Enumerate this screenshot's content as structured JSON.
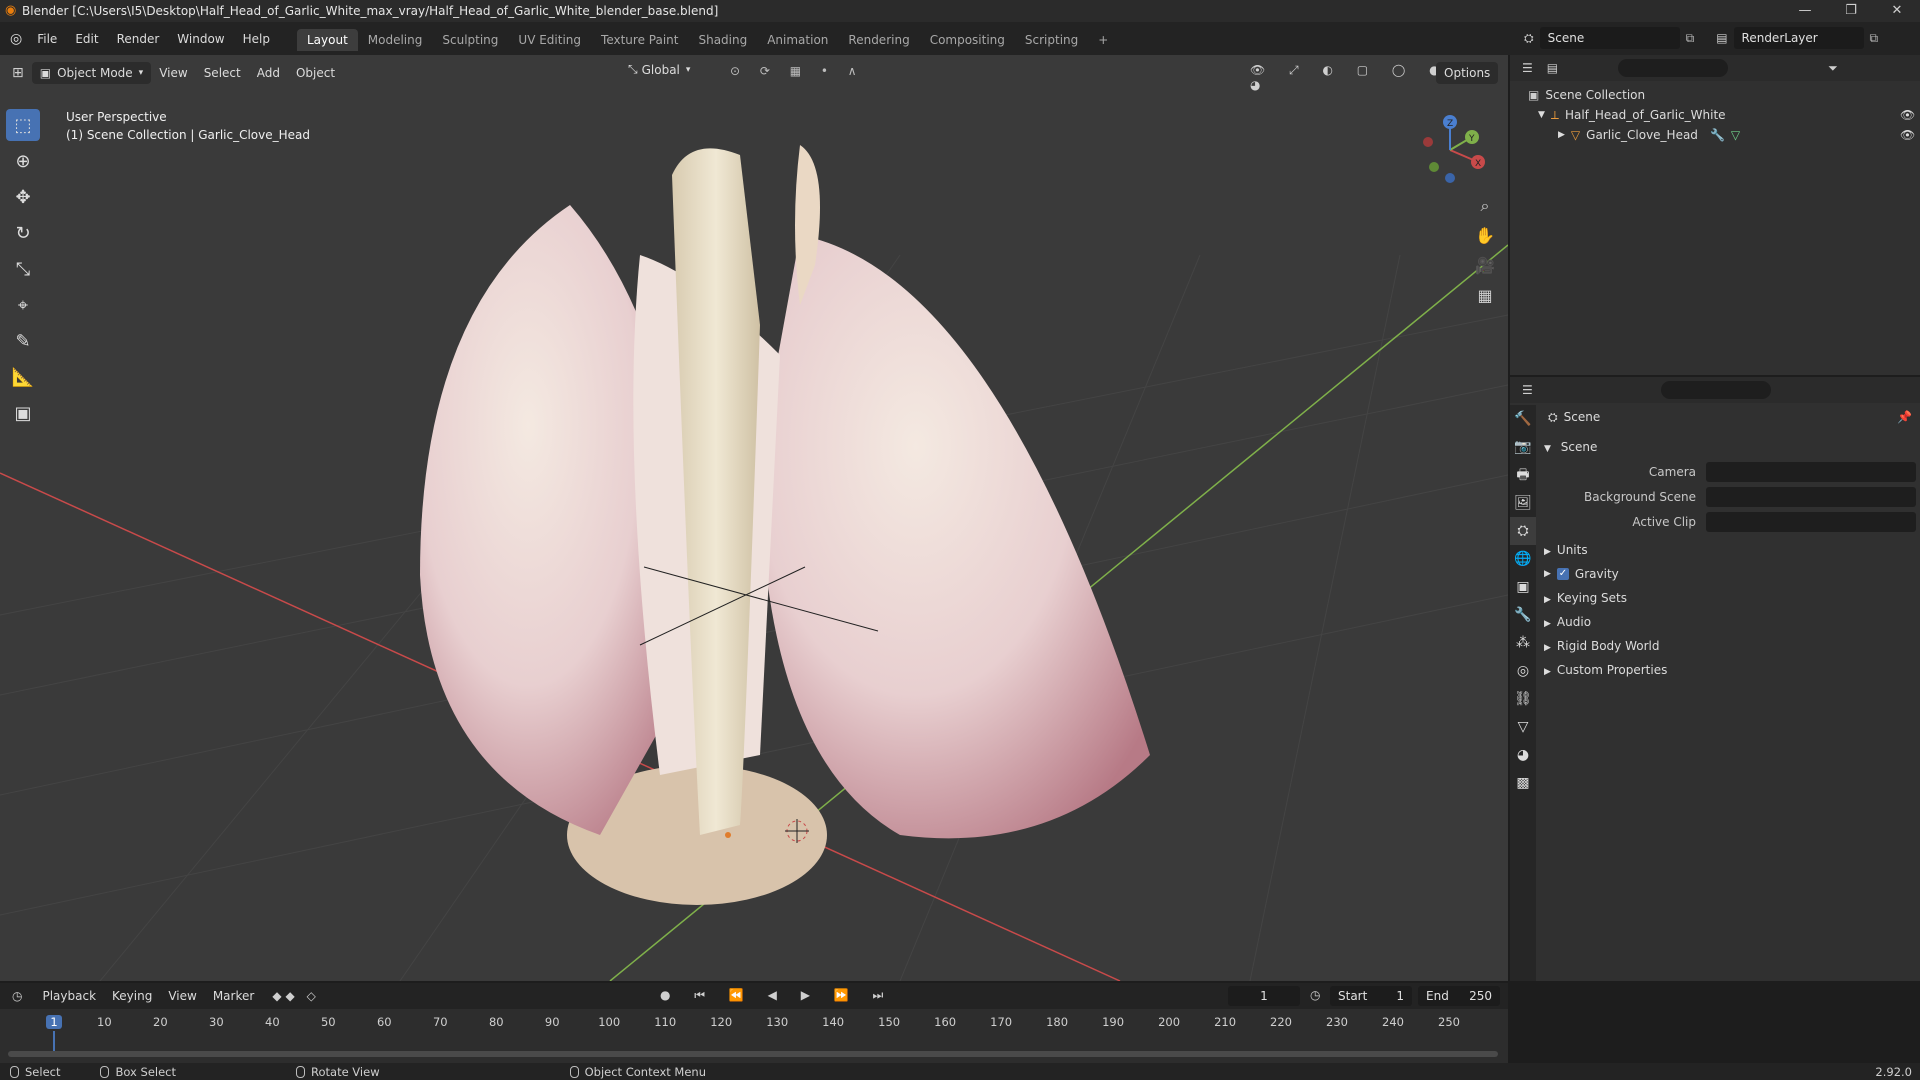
{
  "window": {
    "title": "Blender [C:\\Users\\I5\\Desktop\\Half_Head_of_Garlic_White_max_vray/Half_Head_of_Garlic_White_blender_base.blend]",
    "minimize": "—",
    "maximize": "❐",
    "close": "✕"
  },
  "menu": [
    "File",
    "Edit",
    "Render",
    "Window",
    "Help"
  ],
  "workspaces": [
    "Layout",
    "Modeling",
    "Sculpting",
    "UV Editing",
    "Texture Paint",
    "Shading",
    "Animation",
    "Rendering",
    "Compositing",
    "Scripting"
  ],
  "add_workspace": "+",
  "scene_field": "Scene",
  "renderlayer_field": "RenderLayer",
  "viewport_header": {
    "mode": "Object Mode",
    "menus": [
      "View",
      "Select",
      "Add",
      "Object"
    ],
    "transform_orientation": "Global",
    "options": "Options"
  },
  "viewport_overlay": {
    "line1": "User Perspective",
    "line2": "(1) Scene Collection | Garlic_Clove_Head"
  },
  "gizmo": {
    "x": "X",
    "y": "Y",
    "z": "Z"
  },
  "outliner": {
    "root": "Scene Collection",
    "items": [
      {
        "label": "Half_Head_of_Garlic_White"
      },
      {
        "label": "Garlic_Clove_Head"
      }
    ]
  },
  "properties": {
    "context_title": "Scene",
    "panel_title": "Scene",
    "fields": [
      {
        "label": "Camera"
      },
      {
        "label": "Background Scene"
      },
      {
        "label": "Active Clip"
      }
    ],
    "sections": [
      "Units",
      "Gravity",
      "Keying Sets",
      "Audio",
      "Rigid Body World",
      "Custom Properties"
    ],
    "gravity_checked": true
  },
  "timeline": {
    "menus": [
      "Playback",
      "Keying",
      "View",
      "Marker"
    ],
    "current_frame": "1",
    "start_label": "Start",
    "start_value": "1",
    "end_label": "End",
    "end_value": "250",
    "ruler": [
      "1",
      "10",
      "20",
      "30",
      "40",
      "50",
      "60",
      "70",
      "80",
      "90",
      "100",
      "110",
      "120",
      "130",
      "140",
      "150",
      "160",
      "170",
      "180",
      "190",
      "200",
      "210",
      "220",
      "230",
      "240",
      "250"
    ]
  },
  "statusbar": {
    "items": [
      "Select",
      "Box Select",
      "Rotate View",
      "Object Context Menu"
    ],
    "version": "2.92.0"
  },
  "colors": {
    "accent": "#4772b3",
    "x_axis": "#c84a4a",
    "y_axis": "#7fb04a",
    "z_axis": "#4a7fd0"
  }
}
